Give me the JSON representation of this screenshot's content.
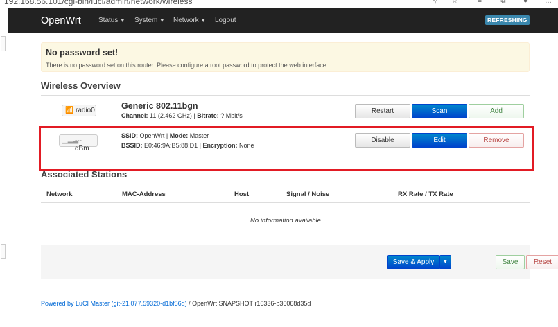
{
  "browser": {
    "url": "192.168.56.101/cgi-bin/luci/admin/network/wireless"
  },
  "navbar": {
    "brand": "OpenWrt",
    "items": [
      "Status",
      "System",
      "Network",
      "Logout"
    ],
    "refreshing": "REFRESHING"
  },
  "warning": {
    "title": "No password set!",
    "text": "There is no password set on this router. Please configure a root password to protect the web interface."
  },
  "wireless": {
    "heading": "Wireless Overview",
    "device": {
      "badge": "radio0",
      "name": "Generic 802.11bgn",
      "channel_label": "Channel:",
      "channel_value": "11 (2.462 GHz)",
      "bitrate_label": "Bitrate:",
      "bitrate_value": "? Mbit/s",
      "buttons": {
        "restart": "Restart",
        "scan": "Scan",
        "add": "Add"
      }
    },
    "network": {
      "badge": "--- dBm",
      "ssid_label": "SSID:",
      "ssid_value": "OpenWrt",
      "mode_label": "Mode:",
      "mode_value": "Master",
      "bssid_label": "BSSID:",
      "bssid_value": "E0:46:9A:B5:88:D1",
      "encryption_label": "Encryption:",
      "encryption_value": "None",
      "buttons": {
        "disable": "Disable",
        "edit": "Edit",
        "remove": "Remove"
      }
    }
  },
  "associated": {
    "heading": "Associated Stations",
    "columns": [
      "Network",
      "MAC-Address",
      "Host",
      "Signal / Noise",
      "RX Rate / TX Rate"
    ],
    "empty": "No information available"
  },
  "actions": {
    "save_apply": "Save & Apply",
    "save": "Save",
    "reset": "Reset"
  },
  "footer": {
    "link": "Powered by LuCI Master (git-21.077.59320-d1bf56d)",
    "rest": " / OpenWrt SNAPSHOT r16336-b36068d35d"
  },
  "colors": {
    "accent": "#0044cc",
    "navbar": "#222222",
    "highlight": "#e21b24"
  }
}
